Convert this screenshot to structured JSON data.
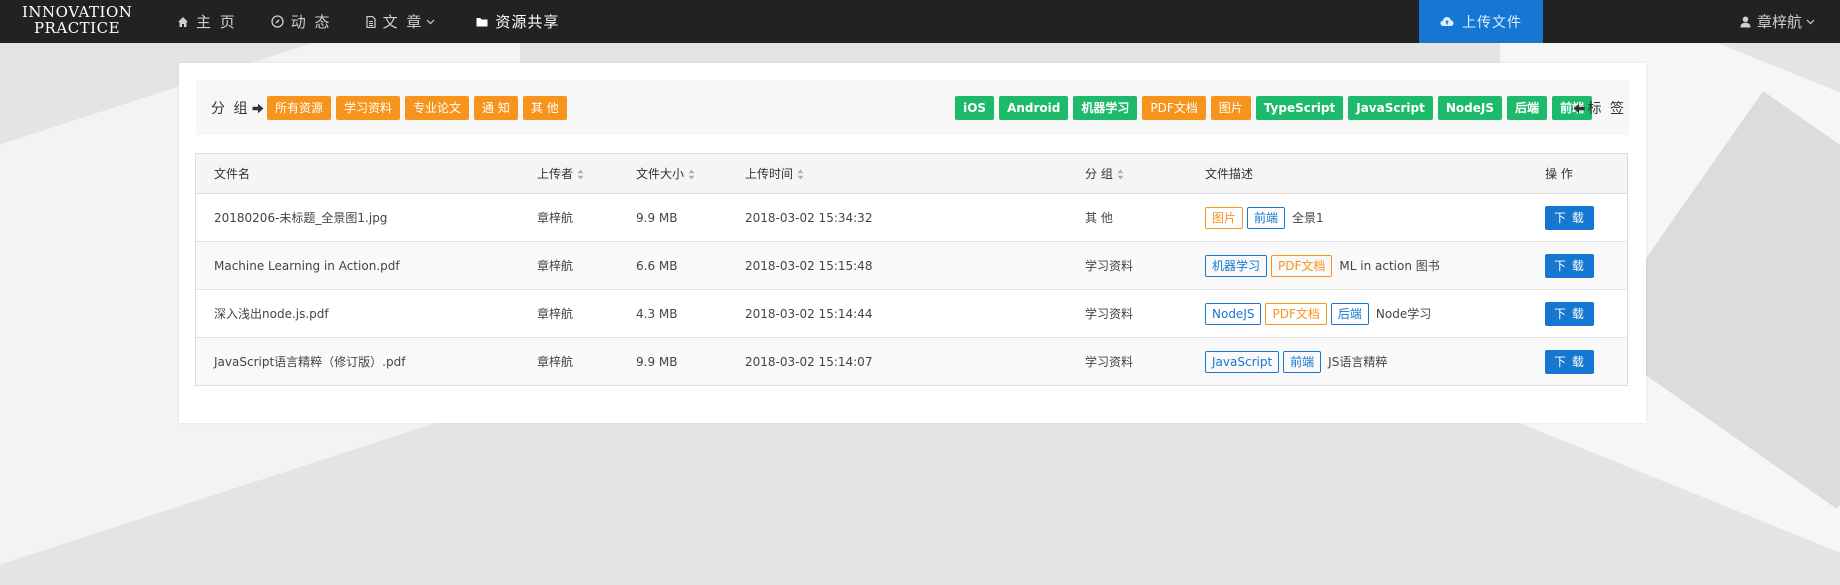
{
  "navbar": {
    "brand_line1": "INNOVATION",
    "brand_line2": "PRACTICE",
    "items": [
      {
        "label": "主 页",
        "icon": "home-icon"
      },
      {
        "label": "动 态",
        "icon": "compass-icon"
      },
      {
        "label": "文 章",
        "icon": "file-icon",
        "dropdown": true
      },
      {
        "label": "资源共享",
        "icon": "folder-icon",
        "active": true
      }
    ],
    "upload_label": "上传文件",
    "user_name": "章梓航",
    "colors": {
      "bar": "#222222",
      "upload": "#1677d2"
    }
  },
  "filter": {
    "group_label": "分 组",
    "groups": [
      "所有资源",
      "学习资料",
      "专业论文",
      "通 知",
      "其 他"
    ],
    "tags": [
      {
        "label": "iOS",
        "color": "green"
      },
      {
        "label": "Android",
        "color": "green"
      },
      {
        "label": "机器学习",
        "color": "green"
      },
      {
        "label": "PDF文档",
        "color": "orange"
      },
      {
        "label": "图片",
        "color": "orange"
      },
      {
        "label": "TypeScript",
        "color": "green"
      },
      {
        "label": "JavaScript",
        "color": "green"
      },
      {
        "label": "NodeJS",
        "color": "green"
      },
      {
        "label": "后端",
        "color": "green"
      },
      {
        "label": "前端",
        "color": "green"
      }
    ],
    "tag_label": "标 签",
    "colors": {
      "orange": "#f7941d",
      "green": "#1cba6a"
    }
  },
  "table": {
    "headers": {
      "name": "文件名",
      "uploader": "上传者",
      "size": "文件大小",
      "time": "上传时间",
      "group": "分 组",
      "desc": "文件描述",
      "action": "操 作"
    },
    "download_label": "下 载",
    "rows": [
      {
        "name": "20180206-未标题_全景图1.jpg",
        "uploader": "章梓航",
        "size": "9.9 MB",
        "time": "2018-03-02 15:34:32",
        "group": "其 他",
        "tags": [
          {
            "label": "图片",
            "color": "orange"
          },
          {
            "label": "前端",
            "color": "blue"
          }
        ],
        "desc": "全景1"
      },
      {
        "name": "Machine Learning in Action.pdf",
        "uploader": "章梓航",
        "size": "6.6 MB",
        "time": "2018-03-02 15:15:48",
        "group": "学习资料",
        "tags": [
          {
            "label": "机器学习",
            "color": "blue"
          },
          {
            "label": "PDF文档",
            "color": "orange"
          }
        ],
        "desc": "ML in action 图书"
      },
      {
        "name": "深入浅出node.js.pdf",
        "uploader": "章梓航",
        "size": "4.3 MB",
        "time": "2018-03-02 15:14:44",
        "group": "学习资料",
        "tags": [
          {
            "label": "NodeJS",
            "color": "blue"
          },
          {
            "label": "PDF文档",
            "color": "orange"
          },
          {
            "label": "后端",
            "color": "blue"
          }
        ],
        "desc": "Node学习"
      },
      {
        "name": "JavaScript语言精粹（修订版）.pdf",
        "uploader": "章梓航",
        "size": "9.9 MB",
        "time": "2018-03-02 15:14:07",
        "group": "学习资料",
        "tags": [
          {
            "label": "JavaScript",
            "color": "blue"
          },
          {
            "label": "前端",
            "color": "blue"
          }
        ],
        "desc": "JS语言精粹"
      }
    ]
  }
}
